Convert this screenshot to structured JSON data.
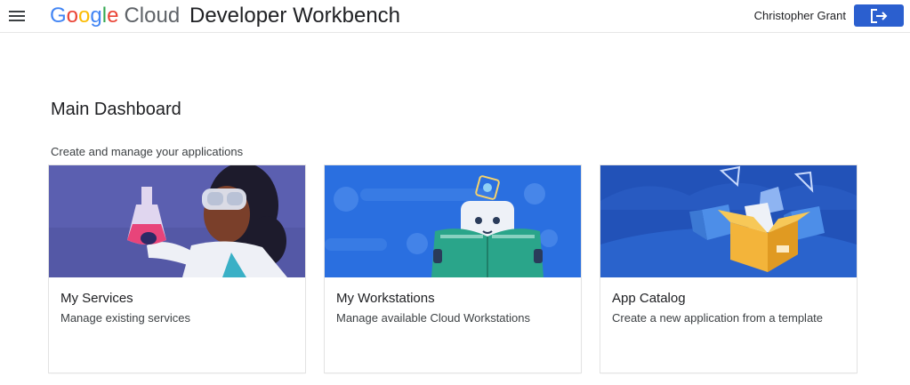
{
  "header": {
    "logo_google": "Google",
    "logo_cloud": "Cloud",
    "app_title": "Developer Workbench",
    "user_name": "Christopher Grant",
    "menu_icon": "hamburger-menu-icon",
    "logout_icon": "logout-icon",
    "accent_color": "#2b5fcf"
  },
  "main": {
    "title": "Main Dashboard",
    "subtitle": "Create and manage your applications"
  },
  "cards": [
    {
      "title": "My Services",
      "description": "Manage existing services",
      "illustration": "scientist-with-flask-illustration",
      "banner_color": "#5b5fb0"
    },
    {
      "title": "My Workstations",
      "description": "Manage available Cloud Workstations",
      "illustration": "robot-reading-book-illustration",
      "banner_color": "#2a6fe0"
    },
    {
      "title": "App Catalog",
      "description": "Create a new application from a template",
      "illustration": "open-boxes-illustration",
      "banner_color": "#2252b8"
    }
  ]
}
